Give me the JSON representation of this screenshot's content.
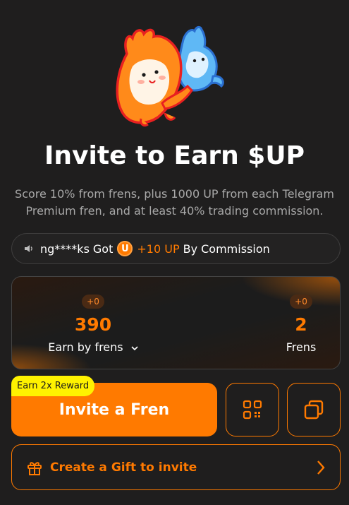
{
  "header": {
    "mascot_icon": "fire-mascot-illustration",
    "title": "Invite to Earn $UP",
    "subtitle": "Score 10% from frens, plus 1000 UP from each Telegram Premium fren, and at least 40% trading commission."
  },
  "ticker": {
    "icon": "speaker-icon",
    "user": "ng****ks",
    "got": "Got",
    "coin_letter": "U",
    "amount": "+10 UP",
    "reason": "By Commission"
  },
  "stats": {
    "earn": {
      "delta": "+0",
      "value": "390",
      "label": "Earn by frens"
    },
    "frens": {
      "delta": "+0",
      "value": "2",
      "label": "Frens"
    }
  },
  "actions": {
    "reward_badge": "Earn 2x Reward",
    "invite_label": "Invite a Fren",
    "qr_icon": "qr-code-icon",
    "copy_icon": "copy-icon",
    "gift_label": "Create a Gift to invite",
    "gift_icon": "gift-icon",
    "gift_arrow_icon": "chevron-right-icon"
  },
  "colors": {
    "background": "#1f1e1e",
    "accent": "#ff7a00",
    "badge": "#fff200",
    "muted_text": "#a8a8a8"
  }
}
